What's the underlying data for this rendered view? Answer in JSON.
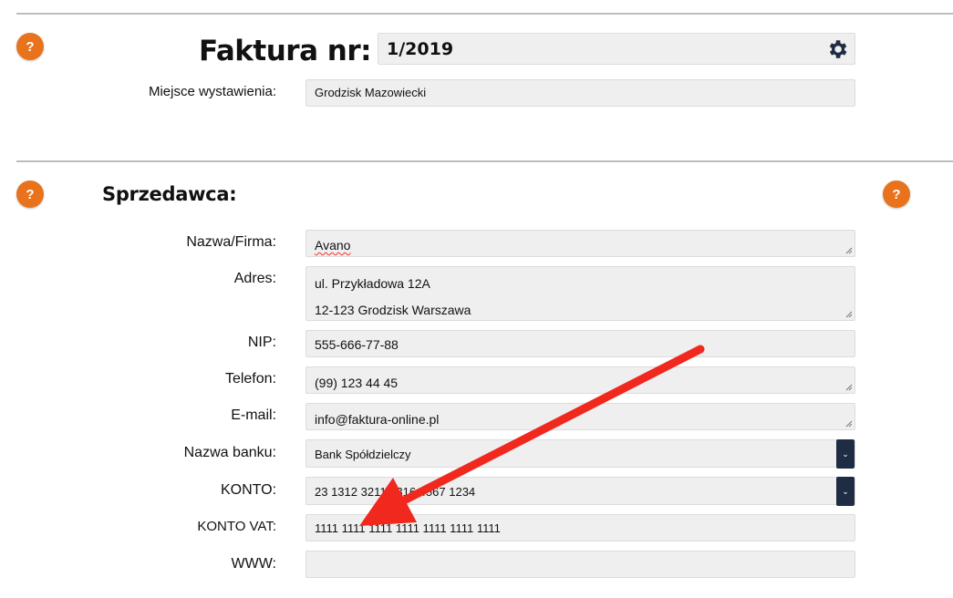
{
  "header": {
    "help_label": "?",
    "invoice_label": "Faktura nr:",
    "invoice_number": "1/2019",
    "place_label": "Miejsce wystawienia:",
    "place_value": "Grodzisk Mazowiecki"
  },
  "seller": {
    "title": "Sprzedawca:",
    "help_label": "?",
    "fields": {
      "name_label": "Nazwa/Firma:",
      "name_value": "Avano",
      "address_label": "Adres:",
      "address_line1": "ul. Przykładowa 12A",
      "address_line2": "12-123 Grodzisk Warszawa",
      "nip_label": "NIP:",
      "nip_value": "555-666-77-88",
      "phone_label": "Telefon:",
      "phone_value": "(99) 123 44 45",
      "email_label": "E-mail:",
      "email_value": "info@faktura-online.pl",
      "bank_label": "Nazwa banku:",
      "bank_value": "Bank Spółdzielczy",
      "account_label": "KONTO:",
      "account_value": "23 1312 3211 2316 4567 1234",
      "vat_account_label": "KONTO VAT:",
      "vat_account_value": "1111 1111 1111 1111 1111 1111 1111",
      "www_label": "WWW:",
      "www_value": ""
    }
  },
  "colors": {
    "help_orange": "#e8731c",
    "dropdown_navy": "#1e2d44",
    "arrow_red": "#f0281e",
    "field_bg": "#efefef"
  },
  "icons": {
    "settings": "gear-icon",
    "dropdown": "chevron-down-icon"
  }
}
